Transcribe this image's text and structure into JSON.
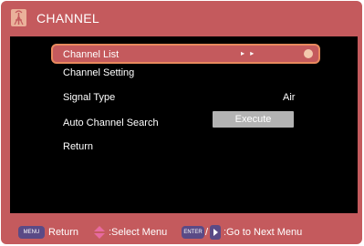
{
  "title": {
    "text": "CHANNEL",
    "icon": "antenna-icon"
  },
  "menu": {
    "items": [
      {
        "label": "Channel List",
        "value": "▸ ▸"
      },
      {
        "label": "Channel Setting"
      },
      {
        "label": "Signal Type",
        "value": "Air"
      },
      {
        "label": "Auto Channel Search",
        "button": "Execute"
      },
      {
        "label": "Return"
      }
    ]
  },
  "footer": {
    "menu_key": "MENU",
    "return_label": "Return",
    "select_label": ":Select Menu",
    "enter_key": "ENTER",
    "slash": "/",
    "goto_label": ":Go to Next Menu"
  },
  "colors": {
    "frame": "#c45a5d",
    "panel": "#000000",
    "selection_border": "#e88a5e",
    "key_badge": "#5a4a86",
    "button": "#b3b3b3"
  }
}
